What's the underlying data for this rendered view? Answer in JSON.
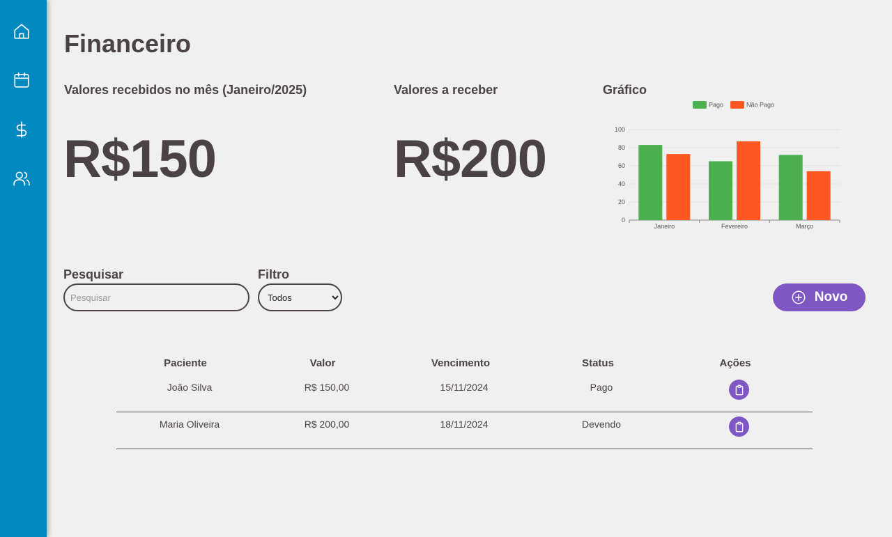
{
  "sidebar": {
    "items": [
      {
        "icon": "home-icon"
      },
      {
        "icon": "calendar-icon"
      },
      {
        "icon": "dollar-icon"
      },
      {
        "icon": "users-icon"
      }
    ]
  },
  "page": {
    "title": "Financeiro"
  },
  "cards": {
    "received": {
      "title": "Valores recebidos no mês (Janeiro/2025)",
      "value": "R$150"
    },
    "receivable": {
      "title": "Valores a receber",
      "value": "R$200"
    },
    "chart": {
      "title": "Gráfico"
    }
  },
  "chart_data": {
    "type": "bar",
    "categories": [
      "Janeiro",
      "Fevereiro",
      "Março"
    ],
    "series": [
      {
        "name": "Pago",
        "values": [
          83,
          65,
          72
        ],
        "color": "#4caf50"
      },
      {
        "name": "Não Pago",
        "values": [
          73,
          87,
          54
        ],
        "color": "#ff5722"
      }
    ],
    "ylim": [
      0,
      100
    ],
    "yticks": [
      0,
      20,
      40,
      60,
      80,
      100
    ],
    "legend": "top",
    "grid": true
  },
  "search": {
    "label": "Pesquisar",
    "placeholder": "Pesquisar",
    "value": ""
  },
  "filter": {
    "label": "Filtro",
    "selected": "Todos"
  },
  "new_button": {
    "label": "Novo",
    "icon": "plus-circle-icon",
    "color": "#7e57c2"
  },
  "table": {
    "headers": [
      "Paciente",
      "Valor",
      "Vencimento",
      "Status",
      "Ações"
    ],
    "rows": [
      {
        "paciente": "João Silva",
        "valor": "R$ 150,00",
        "vencimento": "15/11/2024",
        "status": "Pago",
        "action_icon": "clipboard-icon"
      },
      {
        "paciente": "Maria Oliveira",
        "valor": "R$ 200,00",
        "vencimento": "18/11/2024",
        "status": "Devendo",
        "action_icon": "clipboard-icon"
      }
    ]
  },
  "colors": {
    "sidebar": "#0289c0",
    "accent": "#7e57c2",
    "background": "#f0f0f0",
    "text": "#4a4244"
  }
}
